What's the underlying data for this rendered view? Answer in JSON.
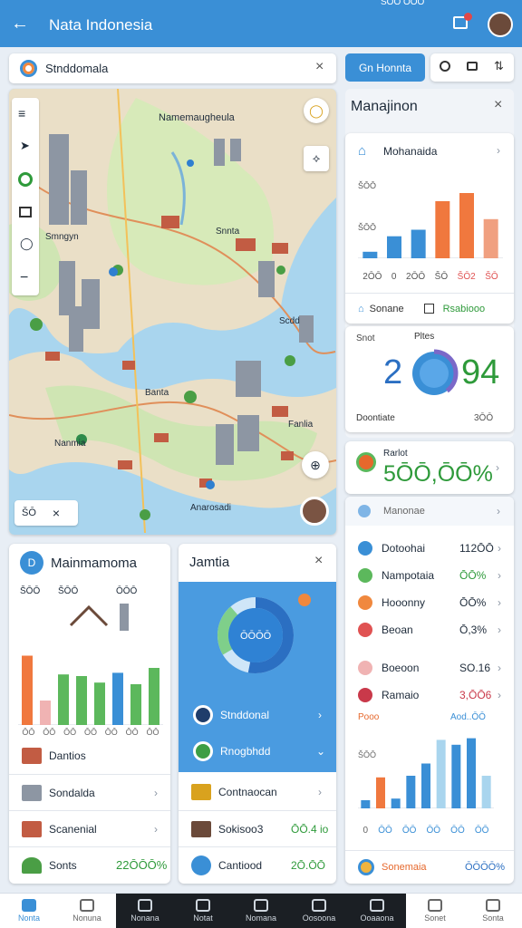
{
  "status": {
    "time": "ŠŌŌ ŌŌŌ"
  },
  "appbar": {
    "title": "Nata Indonesia",
    "color": "#3a8fd6"
  },
  "search": {
    "value": "Stnddomala"
  },
  "top_actions": {
    "button_label": "Gn Honnta"
  },
  "map": {
    "labels": {
      "main": "Namemaugheula",
      "a": "Snnta",
      "b": "Smngyn",
      "c": "Scdd",
      "d": "Fanlia",
      "e": "Nanmia",
      "f": "Anarosadi",
      "g": "Banta"
    },
    "scale_label": "ŠŌ"
  },
  "manage_panel": {
    "title": "Manajinon",
    "card1": {
      "title": "Mohanaida",
      "y_ticks": [
        "ŠŌŌ",
        "ŠŌŌ"
      ],
      "x_ticks": [
        "2ŌŌ",
        "0",
        "2ŌŌ",
        "ŠŌ",
        "ŠŌ2",
        "ŠŌ"
      ],
      "chart_data": {
        "type": "bar",
        "categories": [
          "2ŌŌ",
          "0",
          "2ŌŌ",
          "ŠŌ",
          "ŠŌ2",
          "ŠŌ"
        ],
        "values": [
          8,
          27,
          35,
          70,
          80,
          48
        ],
        "ylim": [
          0,
          100
        ]
      },
      "tab_left": "Sonane",
      "tab_right": "Rsabiooo"
    },
    "card2": {
      "small_label": "Snot",
      "top_label": "Pltes",
      "big_left": "2",
      "big_right": "94",
      "footer_left": "Doontiate",
      "footer_right": "3ŌŌ"
    },
    "card3": {
      "title": "Rarlot",
      "value": "5ŌŌ,ŌŌ%"
    }
  },
  "stats_list": {
    "header": "Manonae",
    "items": [
      {
        "label": "Dotoohai",
        "value": "112ŌŌ",
        "color": "#3a8fd6",
        "value_color": "#1e2b3a"
      },
      {
        "label": "Nampotaia",
        "value": "ŌŌ%",
        "color": "#5cb85c",
        "value_color": "#2e9a3a"
      },
      {
        "label": "Hooonny",
        "value": "ŌŌ%",
        "color": "#f0883e",
        "value_color": "#1e2b3a"
      },
      {
        "label": "Beoan",
        "value": "Ō,3%",
        "color": "#e05252",
        "value_color": "#1e2b3a"
      },
      {
        "label": "Boeoon",
        "value": "SO.16",
        "color": "#f0b3b3",
        "value_color": "#1e2b3a"
      },
      {
        "label": "Ramaio",
        "value": "3,ŌŌ6",
        "color": "#c9394a",
        "value_color": "#c9394a"
      }
    ],
    "chart": {
      "label_left": "Pooo",
      "label_right": "Aod..ŌŌ",
      "ytick": "ŠŌŌ",
      "x_ticks": [
        "0",
        "ŌŌ",
        "ŌŌ",
        "ŌŌ",
        "ŌŌ",
        "ŌŌ"
      ],
      "chart_data": {
        "type": "bar",
        "values": [
          10,
          38,
          12,
          40,
          55,
          84,
          78,
          86,
          40
        ],
        "ylim": [
          0,
          100
        ]
      }
    },
    "footer_label": "Sonemaia",
    "footer_value": "ŌŌŌŌ%"
  },
  "main_card": {
    "title": "Mainmamoma",
    "ticks": [
      "ŠŌŌ",
      "ŠŌŌ",
      "ŌŌŌ"
    ],
    "x_ticks": [
      "ŌŌ",
      "ŌŌ",
      "ŌŌ",
      "ŌŌ",
      "ŌŌ",
      "ŌŌ",
      "ŌŌ"
    ],
    "chart_data": {
      "type": "bar",
      "values": [
        85,
        30,
        62,
        60,
        52,
        64,
        50,
        70
      ],
      "ylim": [
        0,
        100
      ]
    },
    "rows": [
      {
        "label": "Dantios",
        "value": ""
      },
      {
        "label": "Sondalda",
        "value": ""
      },
      {
        "label": "Scanenial",
        "value": ""
      },
      {
        "label": "Sonts",
        "value": "22ŌŌŌ%"
      }
    ]
  },
  "mid_card": {
    "title": "Jamtia",
    "donut_label": "ŌŌŌŌ",
    "list": [
      {
        "label": "Stnddonal"
      },
      {
        "label": "Rnogbhdd"
      }
    ],
    "rows": [
      {
        "label": "Contnaocan",
        "value": ""
      },
      {
        "label": "Sokisoo3",
        "value": "ŌŌ.4 io"
      },
      {
        "label": "Cantiood",
        "value": "2Ō.ŌŌ"
      }
    ]
  },
  "bottom_nav": [
    {
      "label": "Nonta",
      "active": true
    },
    {
      "label": "Nonuna"
    },
    {
      "label": "Nonana"
    },
    {
      "label": "Notat"
    },
    {
      "label": "Nomana"
    },
    {
      "label": "Oosoona"
    },
    {
      "label": "Ooaaona"
    },
    {
      "label": "Sonet"
    },
    {
      "label": "Sonta"
    }
  ]
}
